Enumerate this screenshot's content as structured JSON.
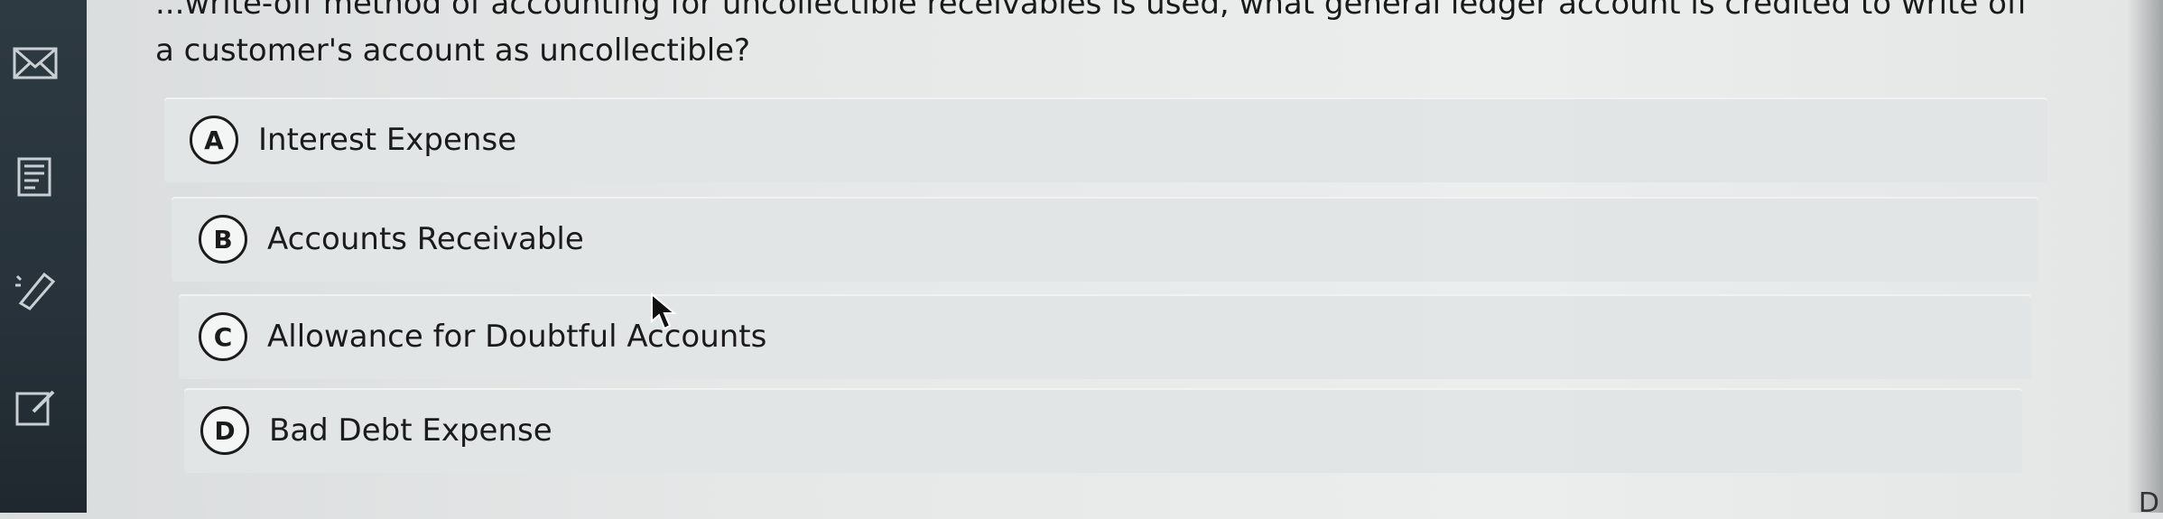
{
  "question": {
    "line1": "...write-off method of accounting for uncollectible receivables is used, what general ledger account is credited to write off",
    "line2": "a customer's account as uncollectible?"
  },
  "options": [
    {
      "letter": "A",
      "text": "Interest Expense"
    },
    {
      "letter": "B",
      "text": "Accounts Receivable"
    },
    {
      "letter": "C",
      "text": "Allowance for Doubtful Accounts"
    },
    {
      "letter": "D",
      "text": "Bad Debt Expense"
    }
  ],
  "sidebar": {
    "icons": [
      "mail-icon",
      "notes-icon",
      "highlight-icon",
      "edit-icon"
    ]
  },
  "edge_text": "D"
}
